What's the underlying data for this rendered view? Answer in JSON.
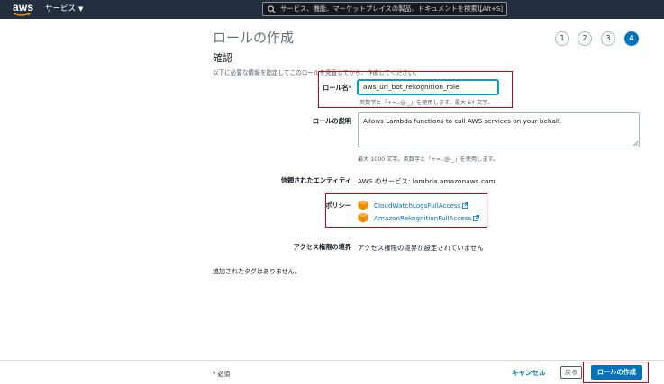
{
  "topbar": {
    "logo_text": "aws",
    "services_label": "サービス",
    "search_placeholder": "サービス、機能、マーケットプレイスの製品、ドキュメントを検索し",
    "search_shortcut": "[Alt+S]"
  },
  "page": {
    "title": "ロールの作成",
    "steps": [
      "1",
      "2",
      "3",
      "4"
    ],
    "active_step": "4",
    "section_title": "確認",
    "description": "以下に必要な情報を指定してこのロールを見直してから、作成してください。"
  },
  "form": {
    "role_name_label": "ロール名*",
    "role_name_value": "aws_url_bot_rekognition_role",
    "role_name_hint": "英数字と「+=,.@-_」を使用します。最大 64 文字。",
    "role_desc_label": "ロールの説明",
    "role_desc_value": "Allows Lambda functions to call AWS services on your behalf.",
    "role_desc_hint": "最大 1000 文字。英数字と「+=,.@-_」を使用します。",
    "trusted_label": "信頼されたエンティティ",
    "trusted_value": "AWS のサービス: lambda.amazonaws.com",
    "policies_label": "ポリシー",
    "policies": [
      {
        "name": "CloudWatchLogsFullAccess",
        "icon": "aws-policy-cube-icon"
      },
      {
        "name": "AmazonRekognitionFullAccess",
        "icon": "aws-policy-cube-icon"
      }
    ],
    "boundary_label": "アクセス権限の境界",
    "boundary_value": "アクセス権限の境界が設定されていません",
    "tags_note": "追加されたタグはありません。"
  },
  "footer": {
    "required_note": "* 必須",
    "cancel_label": "キャンセル",
    "back_label": "戻る",
    "create_label": "ロールの作成"
  },
  "colors": {
    "topbar": "#232f3e",
    "accent": "#0073bb",
    "highlight": "#c7001b",
    "policy_icon": "#f29100"
  }
}
